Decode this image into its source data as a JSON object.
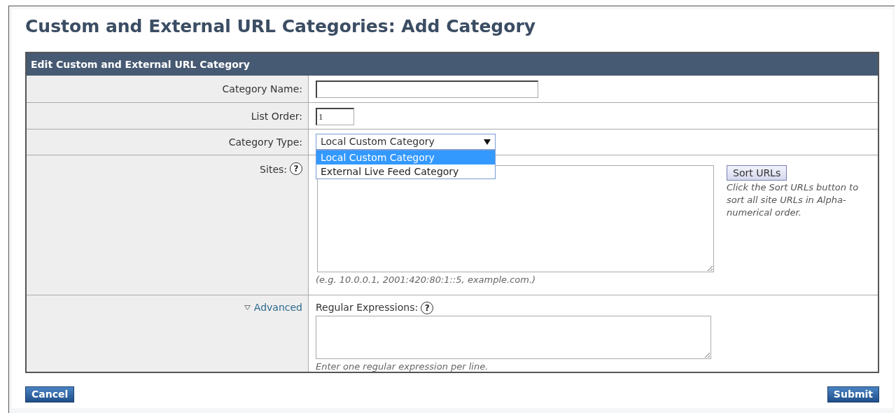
{
  "page_title": "Custom and External URL Categories: Add Category",
  "panel": {
    "header": "Edit Custom and External URL Category",
    "rows": [
      {
        "kind": "text",
        "label": "Category Name:",
        "value": ""
      },
      {
        "kind": "short",
        "label": "List Order:",
        "value": "1"
      },
      {
        "kind": "select",
        "label": "Category Type:",
        "value": "Local Custom Category",
        "expanded": true,
        "options": [
          {
            "label": "Local Custom Category",
            "selected": true
          },
          {
            "label": "External Live Feed Category",
            "selected": false
          }
        ]
      },
      {
        "kind": "sites",
        "label": "Sites:",
        "help": "?",
        "hint": "(e.g. 10.0.0.1, 2001:420:80:1::5, example.com.)",
        "button": "Sort URLs",
        "note": "Click the Sort URLs button to sort all site URLs in Alpha-numerical order."
      },
      {
        "kind": "advanced",
        "label": "Advanced",
        "expanded": true,
        "field_label": "Regular Expressions:",
        "help": "?",
        "hint": "Enter one regular expression per line."
      }
    ]
  },
  "buttons": {
    "cancel": "Cancel",
    "submit": "Submit"
  }
}
